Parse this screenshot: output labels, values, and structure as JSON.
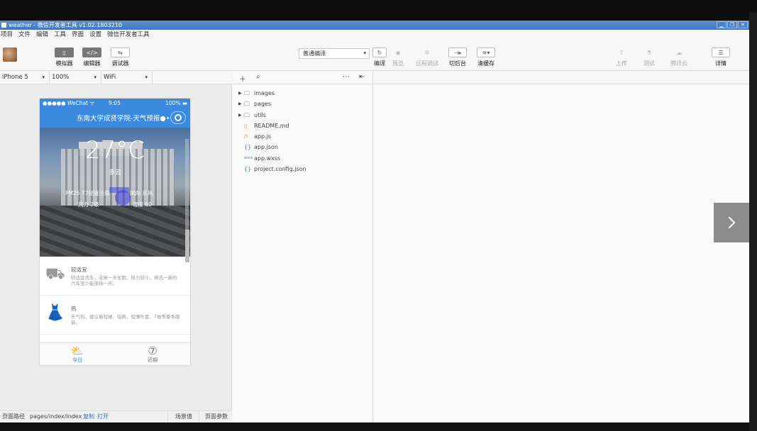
{
  "window": {
    "title": "weather - 微信开发者工具 v1.02.1803210",
    "controls": [
      "▁",
      "❐",
      "✕"
    ]
  },
  "menu": [
    "项目",
    "文件",
    "编辑",
    "工具",
    "界面",
    "设置",
    "微信开发者工具"
  ],
  "toolbar": {
    "simulator": "模拟器",
    "editor": "编辑器",
    "debugger": "调试器",
    "compile_mode": "普通编译",
    "compile": "编译",
    "preview": "预览",
    "remote_debug": "远程调试",
    "background": "切后台",
    "clear_cache": "清缓存",
    "upload": "上传",
    "test": "测试",
    "tencent_cloud": "腾讯云",
    "details": "详情"
  },
  "device": {
    "model": "iPhone 5",
    "zoom": "100%",
    "network": "WiFi"
  },
  "phone": {
    "status_carrier": "●●●●● WeChat ᯤ",
    "status_time": "9:05",
    "status_battery": "100% ▬",
    "nav_title": "东南大学成贤学院-天气预报●•",
    "temperature": "27°C",
    "weather_desc": "多云",
    "info": {
      "pm": "PM25 77轻度污染",
      "wind_dir": "风向 东风",
      "wind_level": "风力 2级",
      "humidity": "湿度 60"
    },
    "suggestions": [
      {
        "icon": "car-icon",
        "title": "较适宜",
        "desc": "较适宜洗车，未来一天无雨，风力较小，擦洗一新的汽车至少能保持一天。"
      },
      {
        "icon": "dress-icon",
        "title": "热",
        "desc": "天气热，建议着短裙、短裤、短薄外套、T恤等夏季服装。"
      }
    ],
    "tabs": [
      {
        "label": "今日",
        "icon": "⛅"
      },
      {
        "label": "近期",
        "icon": "⑦"
      }
    ]
  },
  "files": [
    {
      "name": "images",
      "type": "folder"
    },
    {
      "name": "pages",
      "type": "folder"
    },
    {
      "name": "utils",
      "type": "folder"
    },
    {
      "name": "README.md",
      "type": "md"
    },
    {
      "name": "app.js",
      "type": "js"
    },
    {
      "name": "app.json",
      "type": "json"
    },
    {
      "name": "app.wxss",
      "type": "wxss"
    },
    {
      "name": "project.config.json",
      "type": "json"
    }
  ],
  "bottom": {
    "path_label": "页面路径",
    "path": "pages/index/index",
    "copy": "复制",
    "open": "打开",
    "scene": "场景值",
    "params": "页面参数"
  },
  "colors": {
    "accent": "#3a8be0",
    "titlebar": "#4a83cf"
  }
}
